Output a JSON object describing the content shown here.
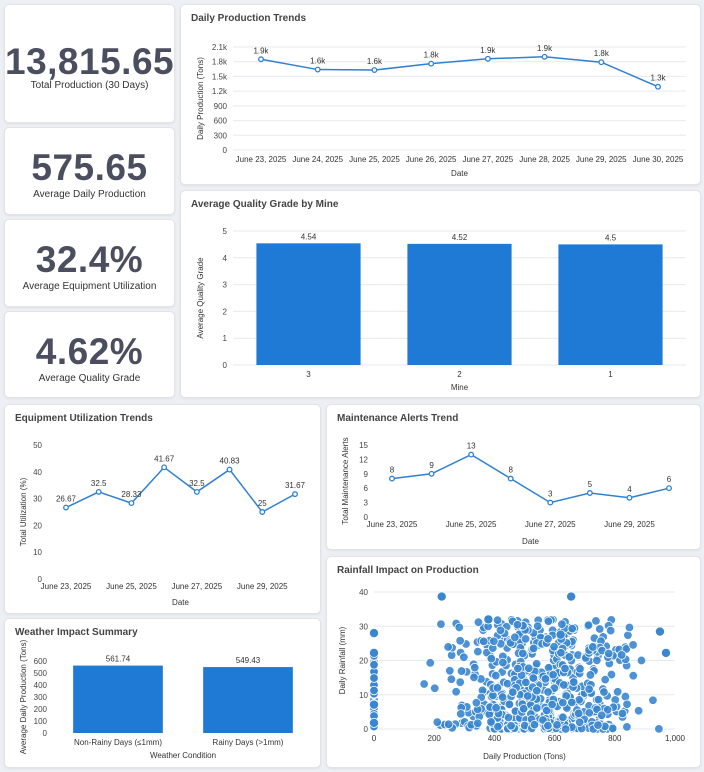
{
  "kpis": [
    {
      "value": "13,815.65",
      "label": "Total Production (30 Days)"
    },
    {
      "value": "575.65",
      "label": "Average Daily Production"
    },
    {
      "value": "32.4%",
      "label": "Average Equipment Utilization"
    },
    {
      "value": "4.62%",
      "label": "Average Quality Grade"
    }
  ],
  "colors": {
    "accent": "#2f80d1",
    "bar": "#1f7ad6",
    "grid": "#e6e9ee"
  },
  "chart_data": [
    {
      "id": "daily",
      "type": "line",
      "title": "Daily Production Trends",
      "xlabel": "Date",
      "ylabel": "Daily Production (Tons)",
      "categories": [
        "June 23, 2025",
        "June 24, 2025",
        "June 25, 2025",
        "June 26, 2025",
        "June 27, 2025",
        "June 28, 2025",
        "June 29, 2025",
        "June 30, 2025"
      ],
      "values": [
        1850,
        1640,
        1630,
        1760,
        1860,
        1900,
        1790,
        1290
      ],
      "data_labels": [
        "1.9k",
        "1.6k",
        "1.6k",
        "1.8k",
        "1.9k",
        "1.9k",
        "1.8k",
        "1.3k"
      ],
      "yticks": [
        "0",
        "300",
        "600",
        "900",
        "1.2k",
        "1.5k",
        "1.8k",
        "2.1k"
      ],
      "ylim": [
        0,
        2100
      ],
      "grid": true
    },
    {
      "id": "quality",
      "type": "bar",
      "title": "Average Quality Grade by Mine",
      "xlabel": "Mine",
      "ylabel": "Average Quality Grade",
      "categories": [
        "3",
        "2",
        "1"
      ],
      "values": [
        4.54,
        4.52,
        4.5
      ],
      "data_labels": [
        "4.54",
        "4.52",
        "4.5"
      ],
      "yticks": [
        "0",
        "1",
        "2",
        "3",
        "4",
        "5"
      ],
      "ylim": [
        0,
        5
      ],
      "grid": true
    },
    {
      "id": "util",
      "type": "line",
      "title": "Equipment Utilization Trends",
      "xlabel": "Date",
      "ylabel": "Total Utilization (%)",
      "xtick_labels": [
        "June 23, 2025",
        "June 25, 2025",
        "June 27, 2025",
        "June 29, 2025"
      ],
      "xtick_positions": [
        0,
        2,
        4,
        6
      ],
      "values": [
        26.67,
        32.5,
        28.33,
        41.67,
        32.5,
        40.83,
        25,
        31.67
      ],
      "data_labels": [
        "26.67",
        "32.5",
        "28.33",
        "41.67",
        "32.5",
        "40.83",
        "25",
        "31.67"
      ],
      "yticks": [
        "0",
        "10",
        "20",
        "30",
        "40",
        "50"
      ],
      "ylim": [
        0,
        50
      ],
      "grid": false
    },
    {
      "id": "maint",
      "type": "line",
      "title": "Maintenance Alerts Trend",
      "xlabel": "Date",
      "ylabel": "Total Maintenance Alerts",
      "xtick_labels": [
        "June 23, 2025",
        "June 25, 2025",
        "June 27, 2025",
        "June 29, 2025"
      ],
      "xtick_positions": [
        0,
        2,
        4,
        6
      ],
      "values": [
        8,
        9,
        13,
        8,
        3,
        5,
        4,
        6
      ],
      "data_labels": [
        "8",
        "9",
        "13",
        "8",
        "3",
        "5",
        "4",
        "6"
      ],
      "yticks": [
        "0",
        "3",
        "6",
        "9",
        "12",
        "15"
      ],
      "ylim": [
        0,
        15
      ],
      "grid": false
    },
    {
      "id": "weather",
      "type": "bar",
      "title": "Weather Impact Summary",
      "xlabel": "Weather Condition",
      "ylabel": "Average Daily Production (Tons)",
      "categories": [
        "Non-Rainy Days (≤1mm)",
        "Rainy Days (>1mm)"
      ],
      "values": [
        561.74,
        549.43
      ],
      "data_labels": [
        "561.74",
        "549.43"
      ],
      "yticks": [
        "0",
        "100",
        "200",
        "300",
        "400",
        "500",
        "600"
      ],
      "ylim": [
        0,
        600
      ],
      "grid": false
    },
    {
      "id": "rain",
      "type": "scatter",
      "title": "Rainfall Impact on Production",
      "xlabel": "Daily Production (Tons)",
      "ylabel": "Daily Rainfall (mm)",
      "xticks": [
        "0",
        "200",
        "400",
        "600",
        "800",
        "1,000"
      ],
      "xlim": [
        0,
        1000
      ],
      "yticks": [
        "0",
        "10",
        "20",
        "30",
        "40"
      ],
      "ylim": [
        0,
        45
      ],
      "grid": true,
      "highlights": [
        [
          0,
          31.5
        ],
        [
          0,
          25
        ],
        [
          225,
          43.5
        ],
        [
          655,
          43.5
        ],
        [
          380,
          36
        ],
        [
          950,
          32
        ],
        [
          620,
          31
        ],
        [
          0,
          8
        ],
        [
          0,
          2
        ],
        [
          970,
          25
        ]
      ]
    }
  ]
}
